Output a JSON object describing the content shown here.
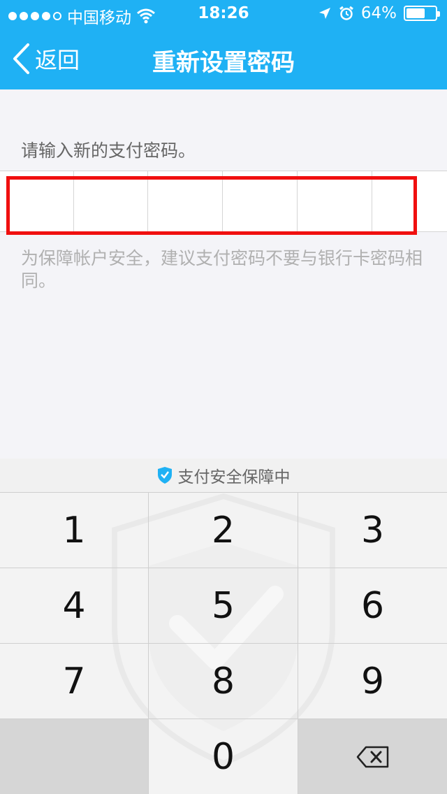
{
  "status_bar": {
    "carrier": "中国移动",
    "time": "18:26",
    "battery": "64%",
    "battery_level": 0.64
  },
  "nav": {
    "back_label": "返回",
    "title": "重新设置密码"
  },
  "form": {
    "prompt": "请输入新的支付密码。",
    "hint": "为保障帐户安全，建议支付密码不要与银行卡密码相同。",
    "pin_length": 6
  },
  "keypad": {
    "secure_label": "支付安全保障中",
    "keys": {
      "k1": "1",
      "k2": "2",
      "k3": "3",
      "k4": "4",
      "k5": "5",
      "k6": "6",
      "k7": "7",
      "k8": "8",
      "k9": "9",
      "k0": "0"
    }
  },
  "icons": {
    "back": "chevron-left-icon",
    "delete": "backspace-icon",
    "secure": "shield-check-icon",
    "wifi": "wifi-icon",
    "location": "location-arrow-icon",
    "alarm": "alarm-icon",
    "battery": "battery-icon"
  },
  "colors": {
    "header_bg": "#1fb1f4",
    "highlight": "#f00f0f",
    "secure_icon": "#1fb1f4"
  }
}
